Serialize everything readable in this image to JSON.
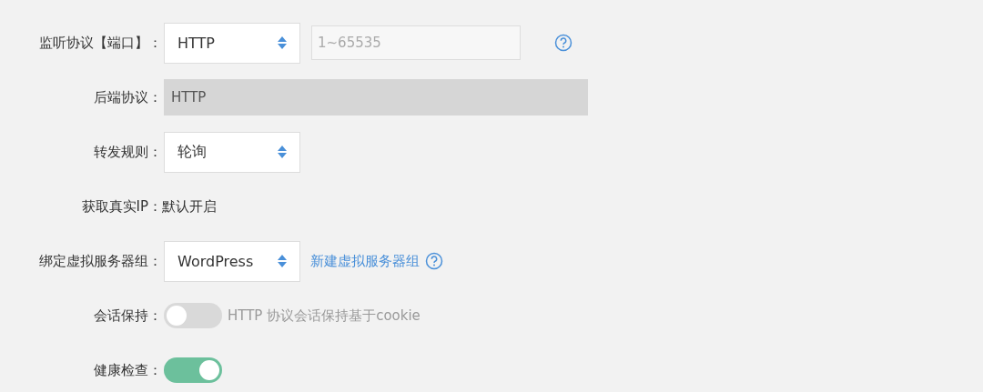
{
  "rows": [
    {
      "kind": "select",
      "label": "监听协议【端口】：",
      "value": "HTTP",
      "input": {
        "placeholder": "1~65535"
      },
      "help": true
    },
    {
      "kind": "readonly",
      "label": "后端协议：",
      "value": "HTTP"
    },
    {
      "kind": "select",
      "label": "转发规则：",
      "value": "轮询"
    },
    {
      "kind": "text",
      "label": "获取真实IP：",
      "value": "默认开启"
    },
    {
      "kind": "select",
      "label": "绑定虚拟服务器组：",
      "value": "WordPress",
      "link": "新建虚拟服务器组",
      "help": true
    },
    {
      "kind": "toggle",
      "label": "会话保持：",
      "on": false,
      "note": "HTTP 协议会话保持基于cookie"
    },
    {
      "kind": "toggle",
      "label": "健康检查：",
      "on": true
    }
  ]
}
